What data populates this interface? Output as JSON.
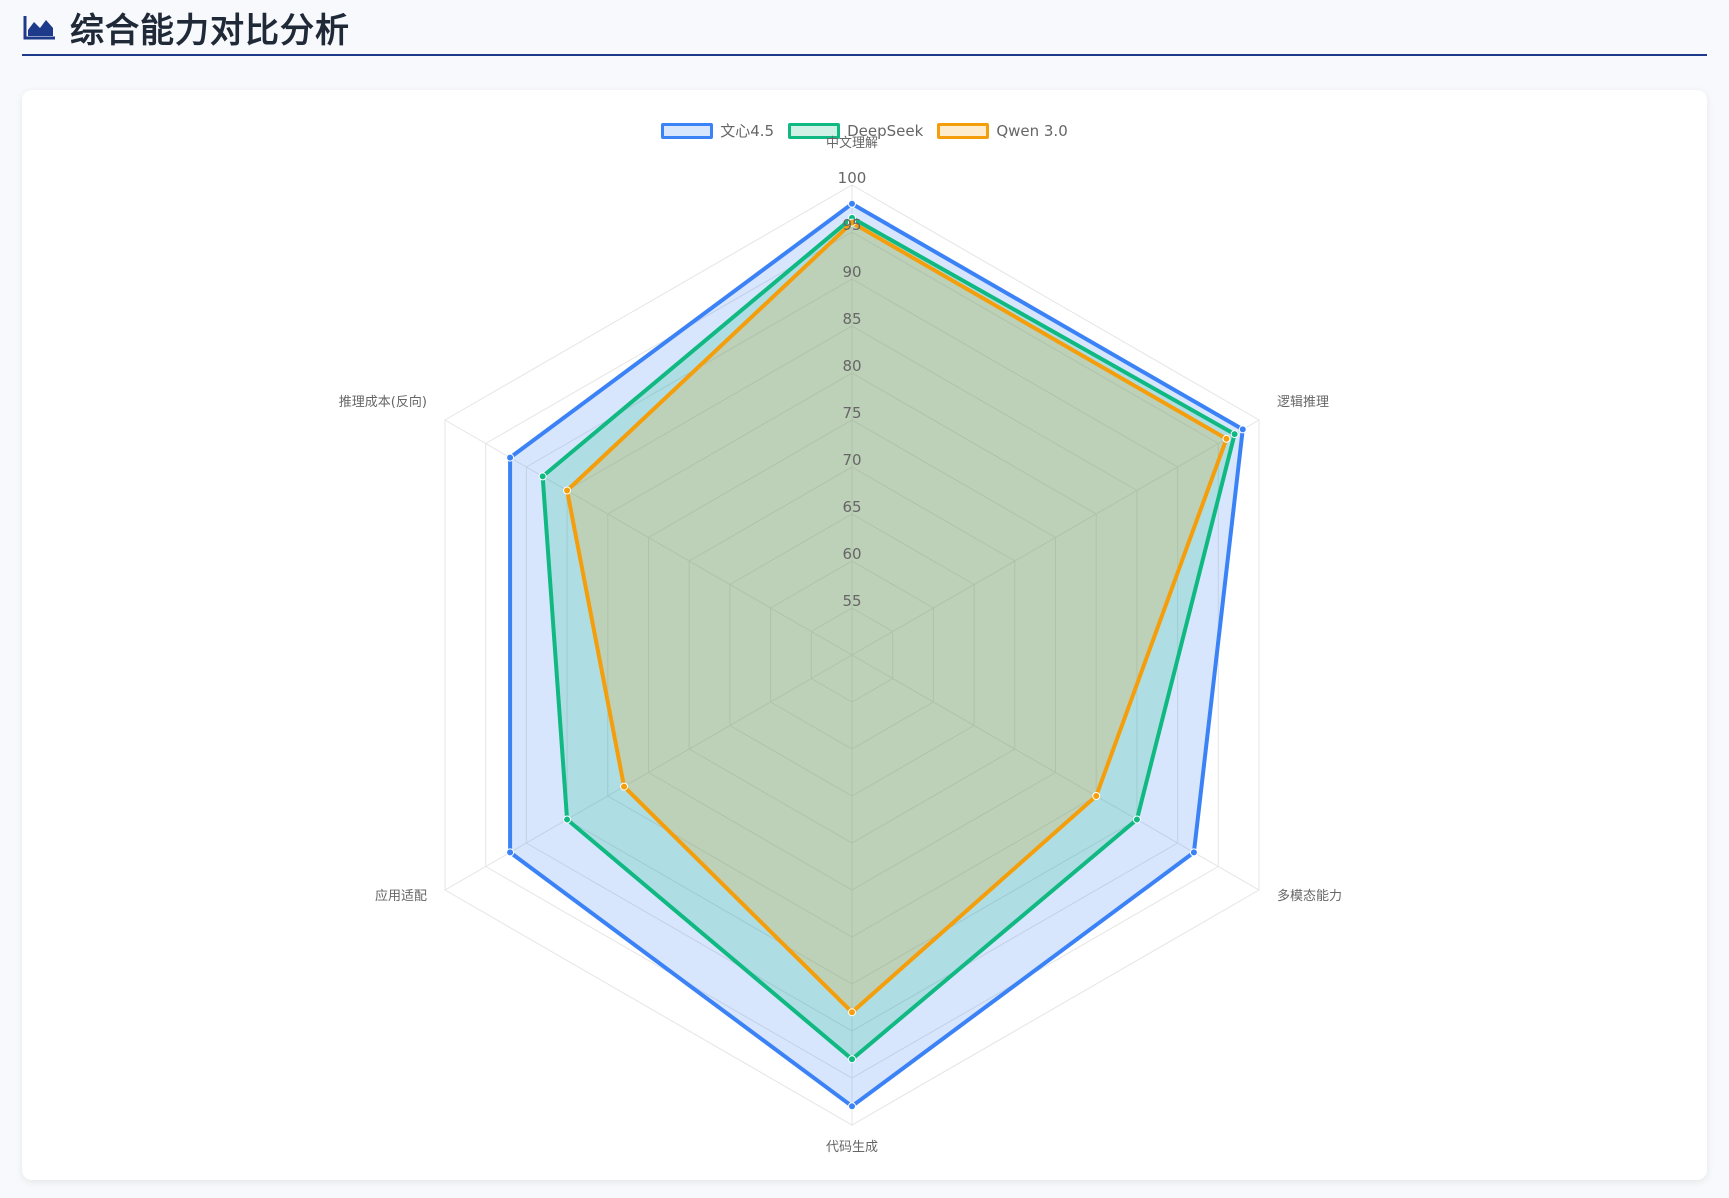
{
  "header": {
    "title": "综合能力对比分析",
    "icon": "area-chart-icon",
    "accent_color": "#1e3a8a"
  },
  "chart_data": {
    "type": "radar",
    "axes": [
      "中文理解",
      "逻辑推理",
      "多模态能力",
      "代码生成",
      "应用适配",
      "推理成本(反向)"
    ],
    "ticks": [
      "55",
      "60",
      "65",
      "70",
      "75",
      "80",
      "85",
      "90",
      "95",
      "100"
    ],
    "rlim": [
      50,
      100
    ],
    "grid": true,
    "legend_position": "top",
    "series": [
      {
        "name": "文心4.5",
        "color": "#3b82f6",
        "fill": "rgba(59,130,246,0.2)",
        "values": [
          98,
          98,
          92,
          98,
          92,
          92
        ]
      },
      {
        "name": "DeepSeek",
        "color": "#10b981",
        "fill": "rgba(16,185,129,0.2)",
        "values": [
          96.5,
          97,
          85,
          93,
          85,
          88
        ]
      },
      {
        "name": "Qwen 3.0",
        "color": "#f59e0b",
        "fill": "rgba(245,158,11,0.2)",
        "values": [
          96,
          96,
          80,
          88,
          78,
          85
        ]
      }
    ]
  }
}
